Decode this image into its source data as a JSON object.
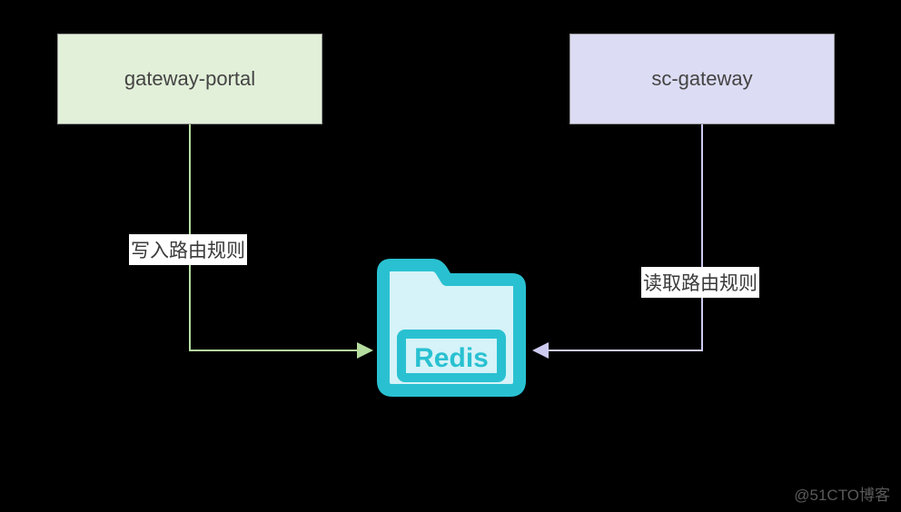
{
  "boxes": {
    "left_label": "gateway-portal",
    "right_label": "sc-gateway"
  },
  "arrows": {
    "left_label": "写入路由规则",
    "right_label": "读取路由规则"
  },
  "center": {
    "redis_label": "Redis"
  },
  "watermark": "@51CTO博客",
  "chart_data": {
    "type": "diagram",
    "nodes": [
      {
        "id": "gateway-portal",
        "label": "gateway-portal",
        "color": "#e2f0d9"
      },
      {
        "id": "sc-gateway",
        "label": "sc-gateway",
        "color": "#dcdcf4"
      },
      {
        "id": "redis",
        "label": "Redis",
        "color": "#29c1d1"
      }
    ],
    "edges": [
      {
        "from": "gateway-portal",
        "to": "redis",
        "label": "写入路由规则",
        "color": "#b5dda0"
      },
      {
        "from": "sc-gateway",
        "to": "redis",
        "label": "读取路由规则",
        "color": "#cccaef"
      }
    ]
  }
}
